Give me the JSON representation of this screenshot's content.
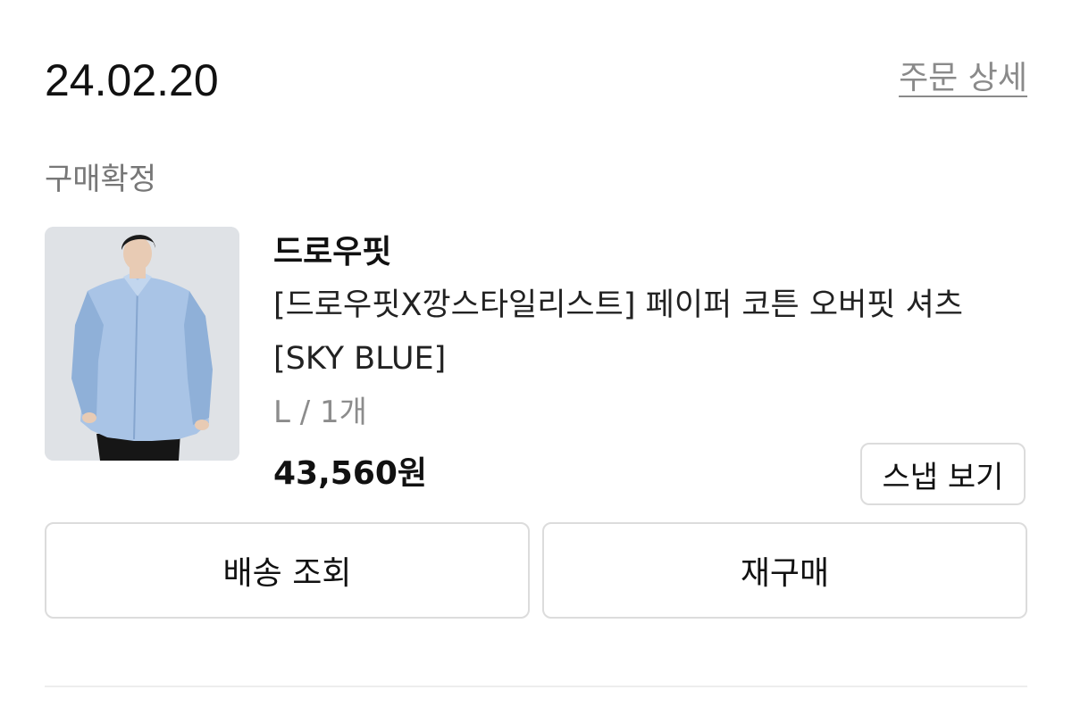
{
  "order": {
    "date": "24.02.20",
    "detail_link": "주문 상세",
    "status": "구매확정"
  },
  "product": {
    "brand": "드로우핏",
    "name_line1": "[드로우핏X깡스타일리스트] 페이퍼 코튼 오버핏 셔츠",
    "name_line2": "[SKY BLUE]",
    "option": "L / 1개",
    "price": "43,560원",
    "image_colors": {
      "background": "#dfe2e6",
      "shirt": "#a9c4e6",
      "shirt_shadow": "#8fb0d8",
      "hair": "#1a1a1a",
      "skin": "#e8cbb4",
      "pants": "#161616"
    }
  },
  "buttons": {
    "snap": "스냅 보기",
    "track_delivery": "배송 조회",
    "rebuy": "재구매"
  }
}
